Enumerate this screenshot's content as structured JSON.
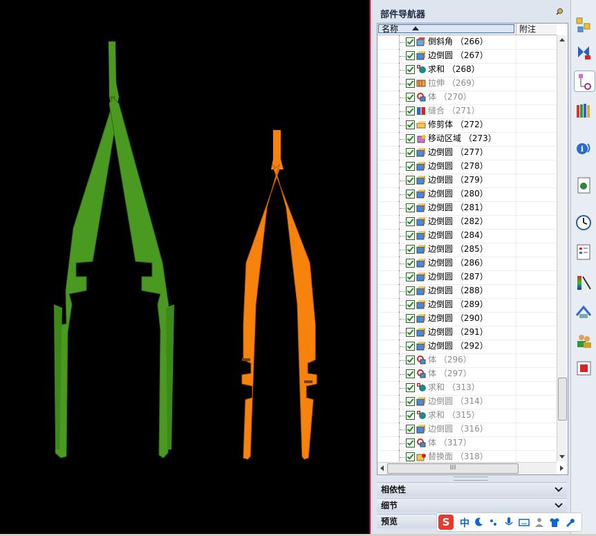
{
  "navigator": {
    "title": "部件导航器",
    "col_name": "名称",
    "col_note": "附注",
    "rows": [
      {
        "label": "倒斜角 （266）",
        "dim": false,
        "icon": "chamfer"
      },
      {
        "label": "边倒圆 （267）",
        "dim": false,
        "icon": "blend"
      },
      {
        "label": "求和 （268）",
        "dim": false,
        "icon": "unite"
      },
      {
        "label": "拉伸 （269）",
        "dim": true,
        "icon": "extrude"
      },
      {
        "label": "体 （270）",
        "dim": true,
        "icon": "body"
      },
      {
        "label": "缝合 （271）",
        "dim": true,
        "icon": "sew"
      },
      {
        "label": "修剪体 （272）",
        "dim": false,
        "icon": "trim"
      },
      {
        "label": "移动区域 （273）",
        "dim": false,
        "icon": "move"
      },
      {
        "label": "边倒圆 （277）",
        "dim": false,
        "icon": "blend"
      },
      {
        "label": "边倒圆 （278）",
        "dim": false,
        "icon": "blend"
      },
      {
        "label": "边倒圆 （279）",
        "dim": false,
        "icon": "blend"
      },
      {
        "label": "边倒圆 （280）",
        "dim": false,
        "icon": "blend"
      },
      {
        "label": "边倒圆 （281）",
        "dim": false,
        "icon": "blend"
      },
      {
        "label": "边倒圆 （282）",
        "dim": false,
        "icon": "blend"
      },
      {
        "label": "边倒圆 （284）",
        "dim": false,
        "icon": "blend"
      },
      {
        "label": "边倒圆 （285）",
        "dim": false,
        "icon": "blend"
      },
      {
        "label": "边倒圆 （286）",
        "dim": false,
        "icon": "blend"
      },
      {
        "label": "边倒圆 （287）",
        "dim": false,
        "icon": "blend"
      },
      {
        "label": "边倒圆 （288）",
        "dim": false,
        "icon": "blend"
      },
      {
        "label": "边倒圆 （289）",
        "dim": false,
        "icon": "blend"
      },
      {
        "label": "边倒圆 （290）",
        "dim": false,
        "icon": "blend"
      },
      {
        "label": "边倒圆 （291）",
        "dim": false,
        "icon": "blend"
      },
      {
        "label": "边倒圆 （292）",
        "dim": false,
        "icon": "blend"
      },
      {
        "label": "体 （296）",
        "dim": true,
        "icon": "body"
      },
      {
        "label": "体 （297）",
        "dim": true,
        "icon": "body"
      },
      {
        "label": "求和 （313）",
        "dim": true,
        "icon": "unite"
      },
      {
        "label": "边倒圆 （314）",
        "dim": true,
        "icon": "blend"
      },
      {
        "label": "求和 （315）",
        "dim": true,
        "icon": "unite"
      },
      {
        "label": "边倒圆 （316）",
        "dim": true,
        "icon": "blend"
      },
      {
        "label": "体 （317）",
        "dim": true,
        "icon": "body"
      },
      {
        "label": "替换面 （318）",
        "dim": true,
        "icon": "replace"
      }
    ],
    "hscroll_grip": "III"
  },
  "sections": [
    {
      "title": "相依性"
    },
    {
      "title": "细节"
    },
    {
      "title": "预览"
    }
  ],
  "ime": {
    "logo": "S",
    "mode": "中"
  },
  "colors": {
    "green_part": "#4a9a22",
    "orange_part": "#f7820c",
    "accent": "#c2002a"
  }
}
